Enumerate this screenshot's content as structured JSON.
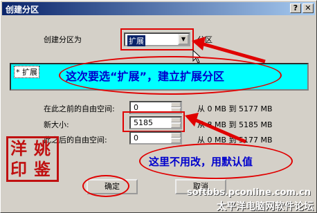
{
  "window": {
    "title": "创建分区",
    "help": "?",
    "close": "✕"
  },
  "create_as": {
    "label": "创建分区为",
    "value": "扩展",
    "suffix": "分区"
  },
  "list": {
    "item": "* 扩展"
  },
  "free_before": {
    "label": "在此之前的自由空间:",
    "value": "0",
    "range_from": "0",
    "range_to": "5177",
    "unit": "MB",
    "from_word": "从",
    "to_word": "到"
  },
  "new_size": {
    "label": "新大小:",
    "value": "5185",
    "range_from": "8",
    "range_to": "5185",
    "unit": "MB",
    "from_word": "从",
    "to_word": "到"
  },
  "free_after": {
    "label": "此之后的自由空间:",
    "value": "0",
    "range_from": "0",
    "range_to": "5177",
    "unit": "MB",
    "from_word": "从",
    "to_word": "到"
  },
  "buttons": {
    "ok": "确定",
    "cancel": "取消"
  },
  "annotations": {
    "extend_note": "这次要选“扩展”，建立扩展分区",
    "default_note": "这里不用改，用默认值"
  },
  "seal": {
    "chars": [
      "洋",
      "姚",
      "印",
      "鉴"
    ],
    "color": "#c01010"
  },
  "watermark": {
    "site": "softbbs.pconline.com.cn",
    "forum": "太平洋电脑网软件论坛"
  },
  "colors": {
    "highlight": "#00ffff",
    "accent_red": "#e00000",
    "annotation_blue": "#0000cc"
  }
}
